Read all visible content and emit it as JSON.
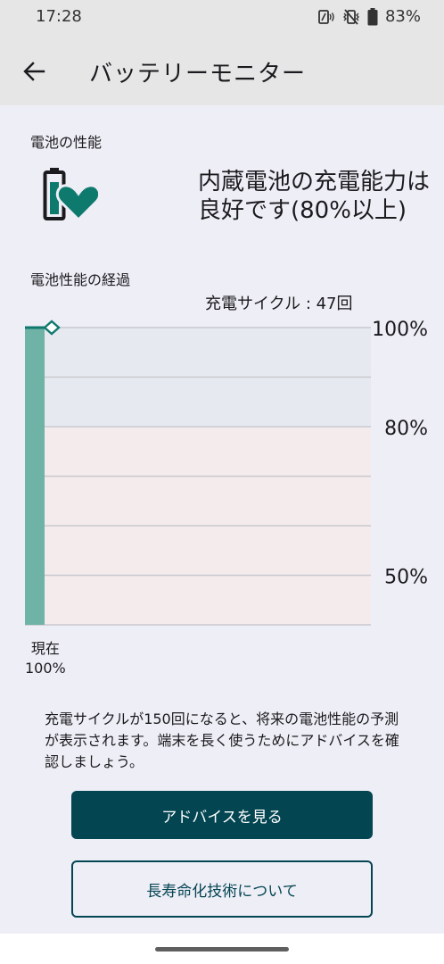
{
  "status_bar": {
    "time": "17:28",
    "battery_percent": "83%",
    "icons": [
      "nfc-icon",
      "vibrate-mute-icon",
      "battery-icon"
    ]
  },
  "app_bar": {
    "title": "バッテリーモニター",
    "back_icon": "back-arrow-icon"
  },
  "performance": {
    "section_label": "電池の性能",
    "icon": "battery-heart-icon",
    "status_line1": "内蔵電池の充電能力は",
    "status_line2": "良好です(80%以上)"
  },
  "history": {
    "section_label": "電池性能の経過",
    "cycle_label": "充電サイクル : 47回",
    "now_label_line1": "現在",
    "now_label_line2": "100%"
  },
  "chart_data": {
    "type": "bar",
    "categories": [
      "現在"
    ],
    "values": [
      100
    ],
    "ylim": [
      40,
      100
    ],
    "yticks": [
      {
        "value": 100,
        "label": "100%"
      },
      {
        "value": 80,
        "label": "80%"
      },
      {
        "value": 50,
        "label": "50%"
      }
    ],
    "grid": true,
    "bands": [
      {
        "from": 80,
        "to": 100,
        "color": "#e6eaf0"
      },
      {
        "from": 40,
        "to": 80,
        "color": "#f3ebec"
      }
    ],
    "bar_color": "#6fb2a6",
    "marker_color": "#0e7a6e"
  },
  "info": {
    "text": "充電サイクルが150回になると、将来の電池性能の予測が表示されます。端末を長く使うためにアドバイスを確認しましょう。"
  },
  "buttons": {
    "advice_label": "アドバイスを見る",
    "longevity_label": "長寿命化技術について"
  },
  "colors": {
    "accent": "#044552",
    "teal": "#0e7a6e",
    "background": "#eeeef6"
  }
}
